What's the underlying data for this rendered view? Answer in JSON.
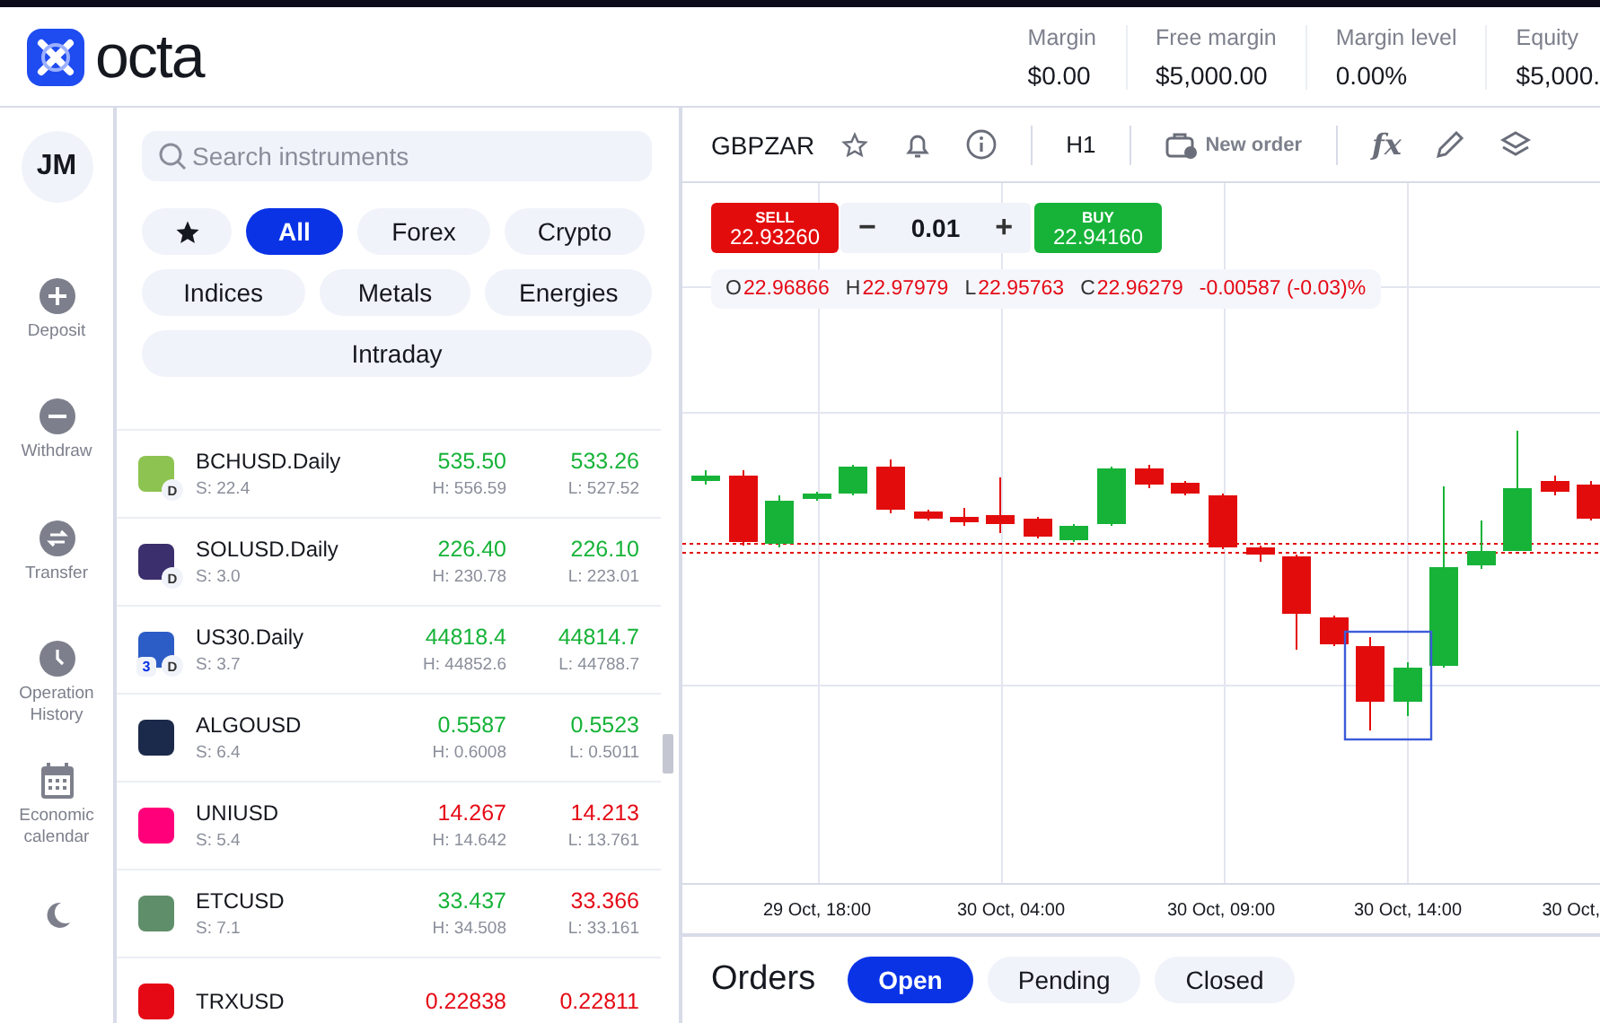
{
  "brand": {
    "name": "octa"
  },
  "account": [
    {
      "label": "Margin",
      "value": "$0.00"
    },
    {
      "label": "Free margin",
      "value": "$5,000.00"
    },
    {
      "label": "Margin level",
      "value": "0.00%"
    },
    {
      "label": "Equity",
      "value": "$5,000."
    }
  ],
  "rail": {
    "avatar": "JM",
    "items": [
      {
        "kind": "plus",
        "label": "Deposit"
      },
      {
        "kind": "minus",
        "label": "Withdraw"
      },
      {
        "kind": "transfer",
        "label": "Transfer"
      },
      {
        "kind": "clock",
        "label": "Operation History"
      },
      {
        "kind": "calendar",
        "label": "Economic calendar"
      },
      {
        "kind": "moon"
      }
    ]
  },
  "search": {
    "placeholder": "Search instruments"
  },
  "filters": [
    {
      "kind": "favorites",
      "selected": false
    },
    {
      "kind": "text",
      "label": "All",
      "selected": true
    },
    {
      "kind": "text",
      "label": "Forex",
      "selected": false
    },
    {
      "kind": "text",
      "label": "Crypto",
      "selected": false
    },
    {
      "kind": "text",
      "label": "Indices",
      "selected": false
    },
    {
      "kind": "text",
      "label": "Metals",
      "selected": false
    },
    {
      "kind": "text",
      "label": "Energies",
      "selected": false
    },
    {
      "kind": "text",
      "label": "Intraday",
      "selected": false
    }
  ],
  "instruments": [
    {
      "symbol": "BCHUSD.Daily",
      "spread": "S: 22.4",
      "bid": "535.50",
      "ask": "533.26",
      "high": "H: 556.59",
      "low": "L: 527.52",
      "bid_rising": true,
      "ask_rising": true,
      "color": "#8dc351",
      "badge": "D"
    },
    {
      "symbol": "SOLUSD.Daily",
      "spread": "S: 3.0",
      "bid": "226.40",
      "ask": "226.10",
      "high": "H: 230.78",
      "low": "L: 223.01",
      "bid_rising": true,
      "ask_rising": true,
      "color": "#3b2f6e",
      "badge": "D"
    },
    {
      "symbol": "US30.Daily",
      "spread": "S: 3.7",
      "bid": "44818.4",
      "ask": "44814.7",
      "high": "H: 44852.6",
      "low": "L: 44788.7",
      "bid_rising": true,
      "ask_rising": true,
      "color": "#2c5cc5",
      "badge": "D",
      "badge_prefix": "3"
    },
    {
      "symbol": "ALGOUSD",
      "spread": "S: 6.4",
      "bid": "0.5587",
      "ask": "0.5523",
      "high": "H: 0.6008",
      "low": "L: 0.5011",
      "bid_rising": true,
      "ask_rising": true,
      "color": "#1b2a4a"
    },
    {
      "symbol": "UNIUSD",
      "spread": "S: 5.4",
      "bid": "14.267",
      "ask": "14.213",
      "high": "H: 14.642",
      "low": "L: 13.761",
      "bid_rising": false,
      "ask_rising": false,
      "color": "#ff007a"
    },
    {
      "symbol": "ETCUSD",
      "spread": "S: 7.1",
      "bid": "33.437",
      "ask": "33.366",
      "high": "H: 34.508",
      "low": "L: 33.161",
      "bid_rising": true,
      "ask_rising": false,
      "color": "#5f8f6a"
    },
    {
      "symbol": "TRXUSD",
      "bid": "0.22838",
      "ask": "0.22811",
      "bid_rising": false,
      "ask_rising": false,
      "color": "#e50915"
    }
  ],
  "chart": {
    "symbol": "GBPZAR",
    "timeframe": "H1",
    "new_order": "New order",
    "indicators": "fx",
    "sell": {
      "label": "SELL",
      "price": "22.93260"
    },
    "volume": "0.01",
    "minus": "−",
    "plus": "+",
    "buy": {
      "label": "BUY",
      "price": "22.94160"
    },
    "ohlc": [
      {
        "key": "O",
        "value": "22.96866"
      },
      {
        "key": "H",
        "value": "22.97979"
      },
      {
        "key": "L",
        "value": "22.95763"
      },
      {
        "key": "C",
        "value": "22.96279"
      }
    ],
    "change": "-0.00587 (-0.03)%",
    "time_labels": [
      "29 Oct, 18:00",
      "30 Oct, 04:00",
      "30 Oct, 09:00",
      "30 Oct, 14:00",
      "30 Oct,"
    ]
  },
  "orders": {
    "title": "Orders",
    "tabs": [
      {
        "label": "Open",
        "selected": true
      },
      {
        "label": "Pending",
        "selected": false
      },
      {
        "label": "Closed",
        "selected": false
      }
    ]
  }
}
